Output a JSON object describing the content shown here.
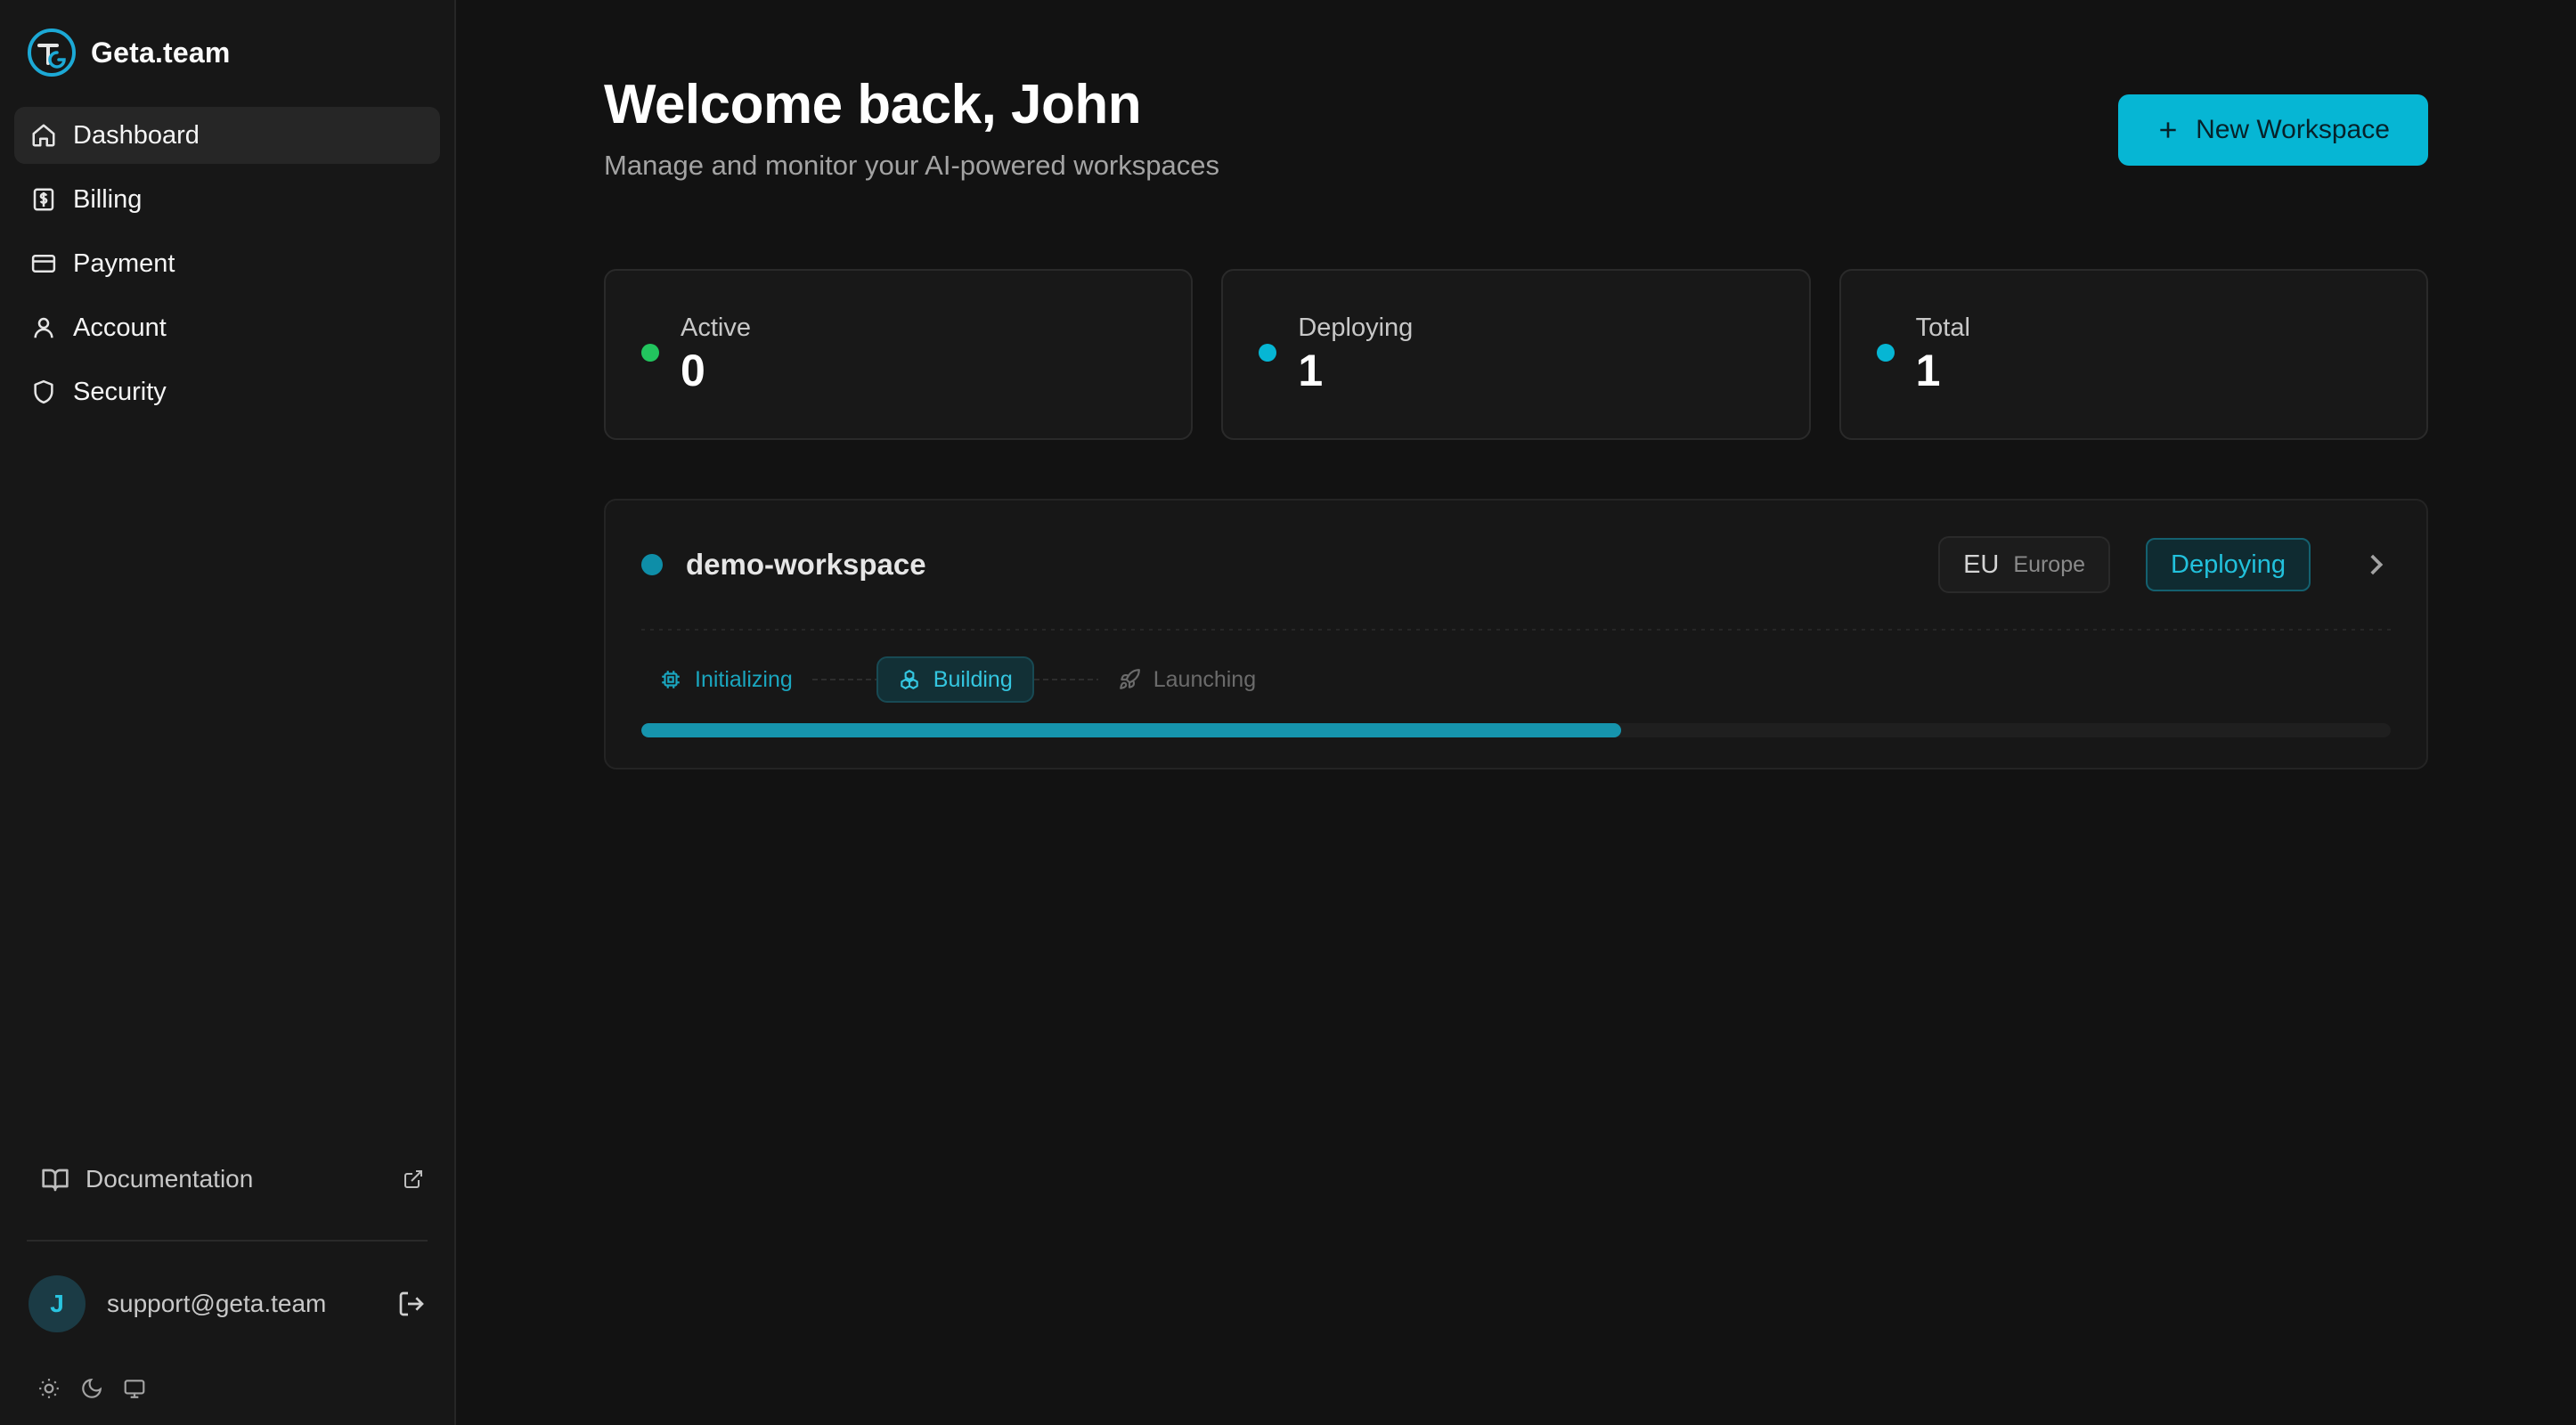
{
  "brand": {
    "name": "Geta.team"
  },
  "sidebar": {
    "items": [
      {
        "label": "Dashboard",
        "icon": "home-icon",
        "active": true
      },
      {
        "label": "Billing",
        "icon": "receipt-dollar-icon",
        "active": false
      },
      {
        "label": "Payment",
        "icon": "credit-card-icon",
        "active": false
      },
      {
        "label": "Account",
        "icon": "user-icon",
        "active": false
      },
      {
        "label": "Security",
        "icon": "shield-icon",
        "active": false
      }
    ],
    "documentation_label": "Documentation",
    "user": {
      "initial": "J",
      "email": "support@geta.team"
    }
  },
  "header": {
    "title": "Welcome back, John",
    "subtitle": "Manage and monitor your AI-powered workspaces",
    "new_workspace_label": "New Workspace"
  },
  "stats": [
    {
      "label": "Active",
      "value": "0",
      "color": "#22c55e"
    },
    {
      "label": "Deploying",
      "value": "1",
      "color": "#06b6d4"
    },
    {
      "label": "Total",
      "value": "1",
      "color": "#06b6d4"
    }
  ],
  "workspace": {
    "name": "demo-workspace",
    "region_code": "EU",
    "region_name": "Europe",
    "status": "Deploying",
    "steps": [
      {
        "label": "Initializing",
        "state": "done"
      },
      {
        "label": "Building",
        "state": "active"
      },
      {
        "label": "Launching",
        "state": "pending"
      }
    ],
    "progress": 0.56
  },
  "colors": {
    "accent": "#06b6d4",
    "active_green": "#22c55e",
    "background": "#121212"
  }
}
